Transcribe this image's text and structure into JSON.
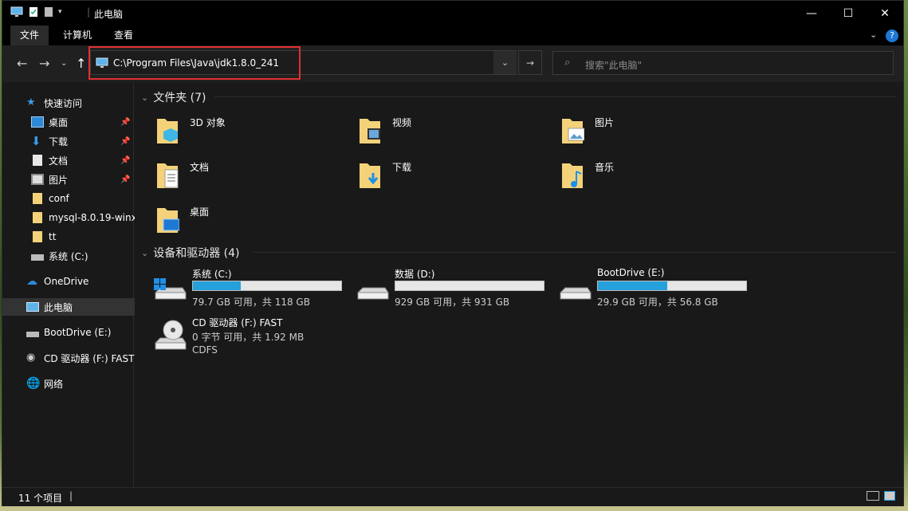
{
  "title_bar": {
    "title": "此电脑",
    "icons": [
      "computer-icon",
      "properties-icon",
      "new-folder-icon",
      "customize-qat-icon"
    ]
  },
  "window_controls": {
    "minimize": "—",
    "maximize": "☐",
    "close": "✕"
  },
  "ribbon": {
    "tabs": [
      "文件",
      "计算机",
      "查看"
    ],
    "active": "文件"
  },
  "address_bar": {
    "path": "C:\\Program Files\\Java\\jdk1.8.0_241"
  },
  "search": {
    "placeholder": "搜索\"此电脑\""
  },
  "sidebar": {
    "items": [
      {
        "label": "快速访问",
        "icon": "star-icon"
      },
      {
        "label": "桌面",
        "icon": "desktop-icon",
        "pinned": true
      },
      {
        "label": "下载",
        "icon": "download-icon",
        "pinned": true
      },
      {
        "label": "文档",
        "icon": "document-icon",
        "pinned": true
      },
      {
        "label": "图片",
        "icon": "picture-icon",
        "pinned": true
      },
      {
        "label": "conf",
        "icon": "folder-icon"
      },
      {
        "label": "mysql-8.0.19-winx",
        "icon": "folder-icon"
      },
      {
        "label": "tt",
        "icon": "folder-icon"
      },
      {
        "label": "系统 (C:)",
        "icon": "drive-icon"
      },
      {
        "label": "OneDrive",
        "icon": "cloud-icon"
      },
      {
        "label": "此电脑",
        "icon": "computer-icon",
        "selected": true
      },
      {
        "label": "BootDrive (E:)",
        "icon": "drive-icon"
      },
      {
        "label": "CD 驱动器 (F:) FAST",
        "icon": "cd-icon"
      },
      {
        "label": "网络",
        "icon": "network-icon"
      }
    ]
  },
  "folders_group": {
    "title": "文件夹 (7)"
  },
  "folders": [
    {
      "label": "3D 对象",
      "icon": "3d-objects-icon"
    },
    {
      "label": "视频",
      "icon": "video-icon"
    },
    {
      "label": "图片",
      "icon": "picture-icon"
    },
    {
      "label": "文档",
      "icon": "document-icon"
    },
    {
      "label": "下载",
      "icon": "download-icon"
    },
    {
      "label": "音乐",
      "icon": "music-icon"
    },
    {
      "label": "桌面",
      "icon": "desktop-icon"
    }
  ],
  "drives_group": {
    "title": "设备和驱动器 (4)"
  },
  "drives": [
    {
      "label": "系统 (C:)",
      "free": "79.7 GB 可用，共 118 GB",
      "used_fraction": 0.32,
      "icon": "windows-drive-icon"
    },
    {
      "label": "数据 (D:)",
      "free": "929 GB 可用，共 931 GB",
      "used_fraction": 0.0,
      "icon": "hard-drive-icon"
    },
    {
      "label": "BootDrive (E:)",
      "free": "29.9 GB 可用，共 56.8 GB",
      "used_fraction": 0.47,
      "icon": "hard-drive-icon"
    },
    {
      "label": "CD 驱动器 (F:) FAST",
      "free": "0 字节 可用，共 1.92 MB",
      "fs": "CDFS",
      "icon": "cd-drive-icon"
    }
  ],
  "status_bar": {
    "count": "11 个项目"
  },
  "colors": {
    "accent": "#26a0da",
    "highlight": "#e03030"
  }
}
